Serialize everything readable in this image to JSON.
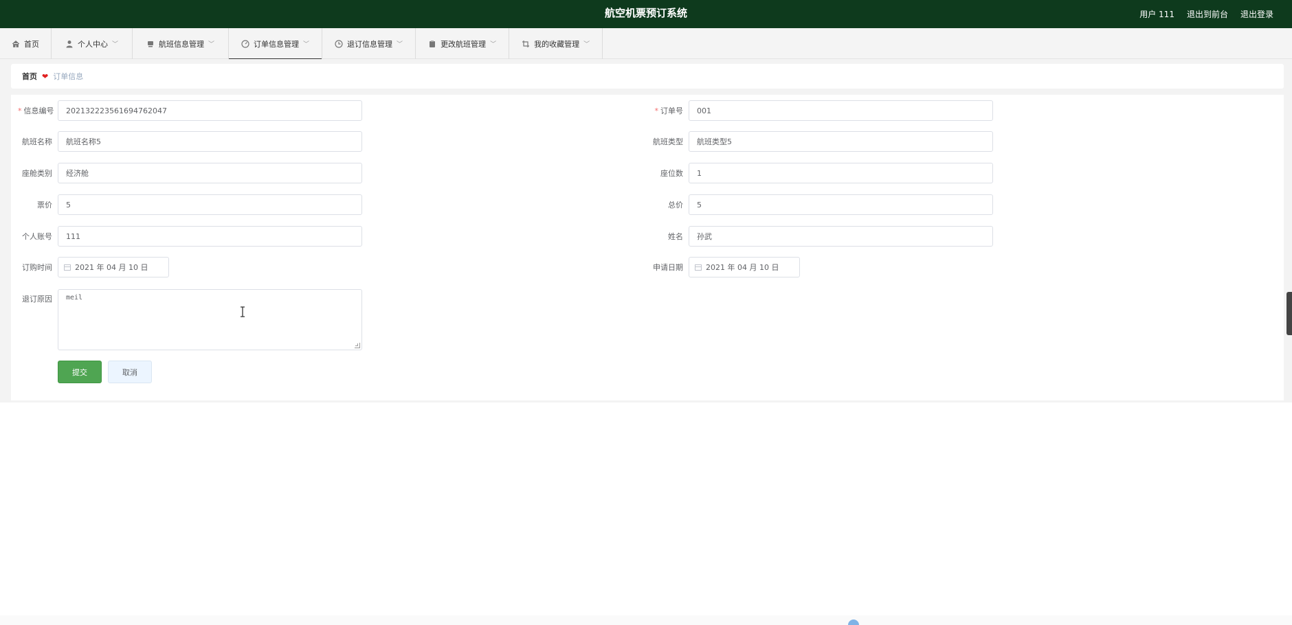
{
  "header": {
    "title": "航空机票预订系统",
    "user": "用户 111",
    "back_front": "退出到前台",
    "logout": "退出登录"
  },
  "nav": {
    "items": [
      {
        "label": "首页",
        "icon": "home-icon"
      },
      {
        "label": "个人中心",
        "icon": "user-icon"
      },
      {
        "label": "航班信息管理",
        "icon": "flight-icon"
      },
      {
        "label": "订单信息管理",
        "icon": "gauge-icon"
      },
      {
        "label": "退订信息管理",
        "icon": "clock-icon"
      },
      {
        "label": "更改航班管理",
        "icon": "clipboard-icon"
      },
      {
        "label": "我的收藏管理",
        "icon": "crop-icon"
      }
    ],
    "active": "订单信息管理"
  },
  "breadcrumb": {
    "home": "首页",
    "current": "订单信息"
  },
  "form": {
    "info_no_label": "信息编号",
    "info_no": "202132223561694762047",
    "order_no_label": "订单号",
    "order_no": "001",
    "flight_name_label": "航班名称",
    "flight_name": "航班名称5",
    "flight_type_label": "航班类型",
    "flight_type": "航班类型5",
    "cabin_label": "座舱类别",
    "cabin": "经济舱",
    "seats_label": "座位数",
    "seats": "1",
    "price_label": "票价",
    "price": "5",
    "total_label": "总价",
    "total": "5",
    "account_label": "个人账号",
    "account": "111",
    "name_label": "姓名",
    "name": "孙武",
    "order_time_label": "订购时间",
    "order_time": "2021 年 04 月 10 日",
    "apply_date_label": "申请日期",
    "apply_date": "2021 年 04 月 10 日",
    "reason_label": "退订原因",
    "reason": "meil",
    "submit": "提交",
    "cancel": "取消"
  },
  "colors": {
    "header_bg": "#0e3a1d",
    "primary": "#4fa552",
    "required": "#f56c6c",
    "heart": "#e02020"
  }
}
